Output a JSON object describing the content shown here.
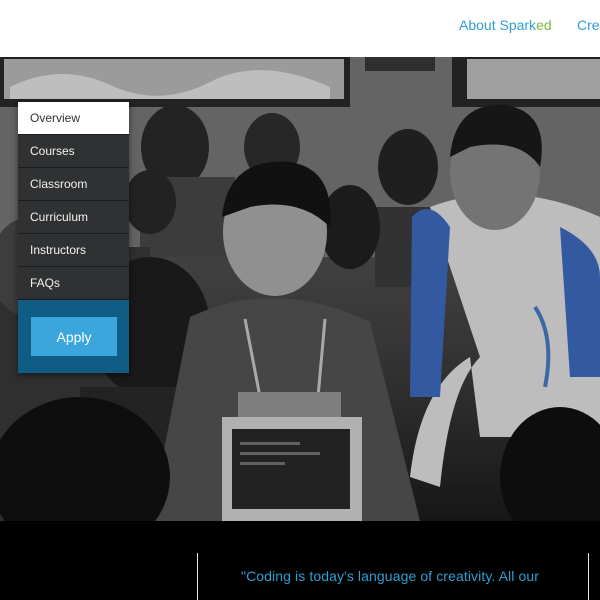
{
  "header": {
    "nav": {
      "about_prefix": "About Spark",
      "about_suffix": "ed",
      "create_label": "Cre"
    },
    "colors": {
      "link": "#2f9fd0",
      "brand_green": "#7ab93e"
    }
  },
  "sidemenu": {
    "items": [
      {
        "label": "Overview",
        "active": true
      },
      {
        "label": "Courses"
      },
      {
        "label": "Classroom"
      },
      {
        "label": "Curriculum"
      },
      {
        "label": "Instructors"
      },
      {
        "label": "FAQs"
      }
    ],
    "apply_label": "Apply",
    "colors": {
      "accent": "#3aa6dc",
      "panel": "#0f5c84"
    }
  },
  "quote": {
    "text": "\"Coding is today's language of creativity. All our"
  }
}
